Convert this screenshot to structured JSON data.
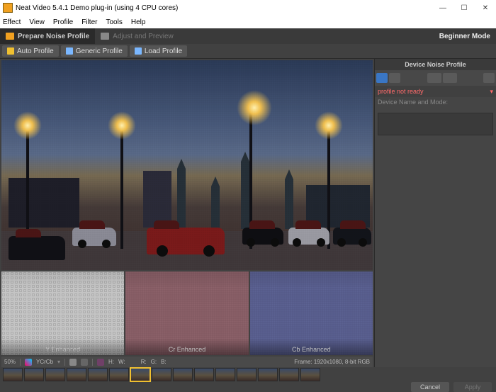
{
  "window": {
    "title": "Neat Video 5.4.1 Demo plug-in (using 4 CPU cores)",
    "min": "—",
    "max": "☐",
    "close": "✕"
  },
  "menu": {
    "effect": "Effect",
    "view": "View",
    "profile": "Profile",
    "filter": "Filter",
    "tools": "Tools",
    "help": "Help"
  },
  "tabs": {
    "prepare": "Prepare Noise Profile",
    "adjust": "Adjust and Preview",
    "mode": "Beginner Mode"
  },
  "toolbar": {
    "auto": "Auto Profile",
    "generic": "Generic Profile",
    "load": "Load Profile"
  },
  "subviews": {
    "y": "Y Enhanced",
    "cr": "Cr Enhanced",
    "cb": "Cb Enhanced"
  },
  "status": {
    "zoom": "50%",
    "space": "YCrCb",
    "h": "H:",
    "w": "W:",
    "r": "R:",
    "g": "G:",
    "b": "B:",
    "frame": "Frame:  1920x1080, 8-bit RGB"
  },
  "panel": {
    "title": "Device Noise Profile",
    "notready": "profile not ready",
    "dropdown": "▾",
    "device_label": "Device Name and Mode:"
  },
  "buttons": {
    "cancel": "Cancel",
    "apply": "Apply"
  },
  "thumbs": {
    "count": 15,
    "active_index": 6
  }
}
